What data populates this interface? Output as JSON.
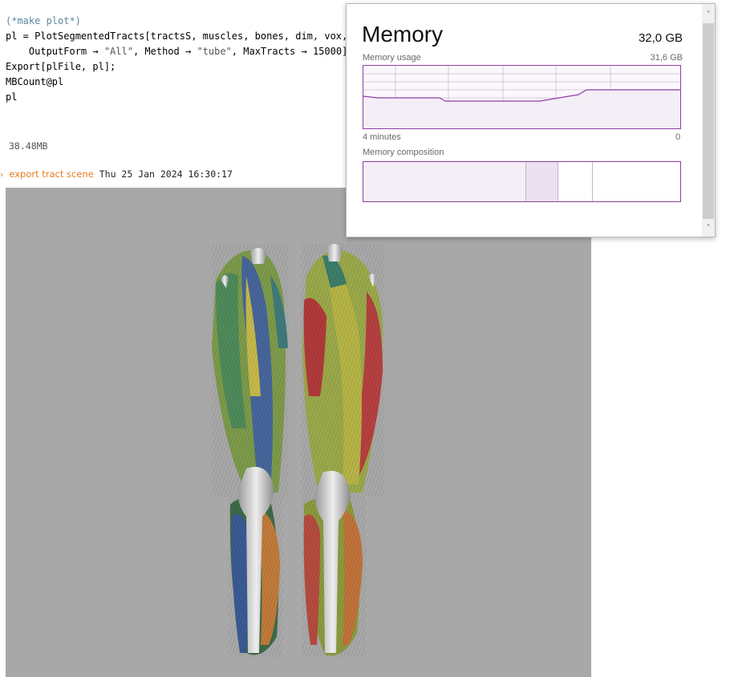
{
  "notebook": {
    "cell_input": {
      "line1": "(*make plot*)",
      "line2": "pl = PlotSegmentedTracts[tractsS, muscles, bones, dim, vox,",
      "line3_a": "    OutputForm → ",
      "line3_s1": "\"All\"",
      "line3_b": ", Method → ",
      "line3_s2": "\"tube\"",
      "line3_c": ", MaxTracts → 15000];",
      "line4": "Export[plFile, pl];",
      "line5": "MBCount@pl",
      "line6": "pl"
    },
    "output_value": "38.48MB",
    "print": {
      "marker": "›",
      "label": "export tract scene",
      "timestamp": "Thu 25 Jan 2024 16:30:17"
    }
  },
  "memory_popup": {
    "title": "Memory",
    "total": "32,0 GB",
    "usage_label": "Memory usage",
    "usage_value": "31,6 GB",
    "time_left": "4 minutes",
    "time_right": "0",
    "composition_label": "Memory composition",
    "colors": {
      "accent": "#8e3fa3",
      "fill_light": "#f4eef6",
      "fill_mid": "#ece1f0"
    }
  },
  "icons": {
    "scroll_up": "chevron-up-icon",
    "scroll_down": "chevron-down-icon"
  },
  "glyphs": {
    "scroll_up": "˄",
    "scroll_down": "˅"
  }
}
